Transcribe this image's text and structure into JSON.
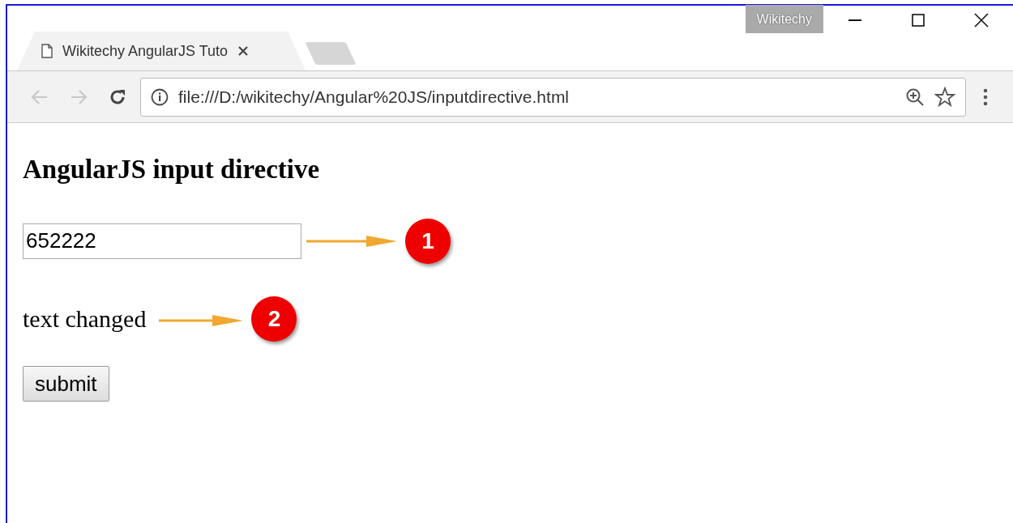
{
  "window": {
    "profile_badge": "Wikitechy"
  },
  "tabs": [
    {
      "title": "Wikitechy AngularJS Tuto",
      "selected": true
    }
  ],
  "navigation": {
    "back_disabled": true,
    "forward_disabled": true
  },
  "address_bar": {
    "url": "file:///D:/wikitechy/Angular%20JS/inputdirective.html"
  },
  "page": {
    "heading": "AngularJS input directive",
    "input": {
      "value": "652222"
    },
    "message": "text changed",
    "button": "submit"
  },
  "callouts": [
    {
      "number": "1"
    },
    {
      "number": "2"
    }
  ]
}
